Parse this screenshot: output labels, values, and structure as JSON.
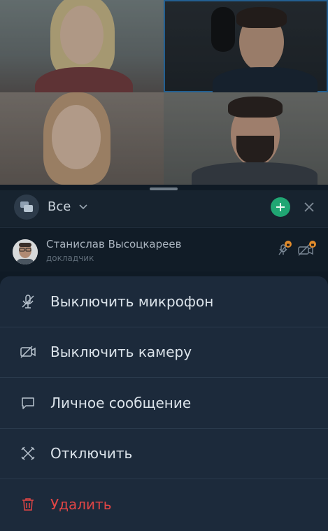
{
  "header": {
    "filter_label": "Все"
  },
  "participant": {
    "name": "Станислав Высоцкареев",
    "role": "докладчик"
  },
  "actions": [
    {
      "label": "Выключить микрофон",
      "icon": "mic-off-icon"
    },
    {
      "label": "Выключить камеру",
      "icon": "camera-off-icon"
    },
    {
      "label": "Личное сообщение",
      "icon": "message-icon"
    },
    {
      "label": "Отключить",
      "icon": "disconnect-icon"
    },
    {
      "label": "Удалить",
      "icon": "trash-icon",
      "color": "#e04545"
    }
  ],
  "colors": {
    "accent_blue": "#2b78b8",
    "add_green": "#20a673",
    "danger_red": "#e04545",
    "lock_badge": "#e08b2c"
  }
}
